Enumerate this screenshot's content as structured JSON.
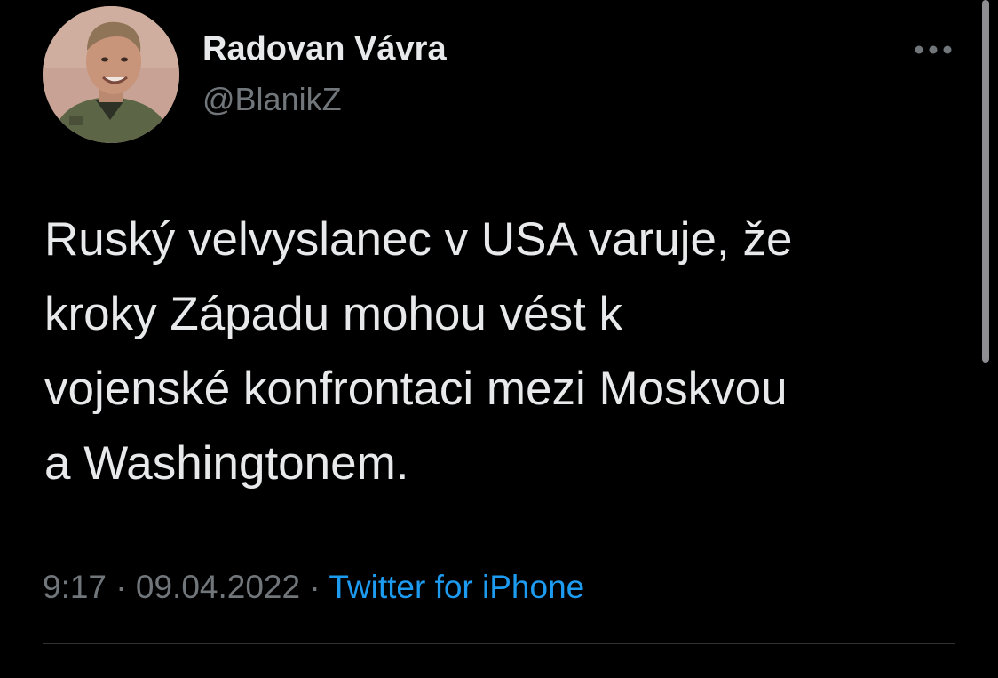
{
  "author": {
    "display_name": "Radovan Vávra",
    "handle": "@BlanikZ",
    "avatar": "profile-photo"
  },
  "more_icon": "more-horizontal-icon",
  "tweet": {
    "lines": [
      "Ruský velvyslanec v USA varuje, že",
      "kroky Západu mohou vést k",
      "vojenské konfrontaci mezi Moskvou",
      "a Washingtonem."
    ]
  },
  "meta": {
    "time": "9:17",
    "separator": "·",
    "date": "09.04.2022",
    "source": "Twitter for iPhone"
  },
  "colors": {
    "background": "#000000",
    "primary_text": "#e7e9ea",
    "secondary_text": "#71767b",
    "link": "#1d9bf0"
  }
}
